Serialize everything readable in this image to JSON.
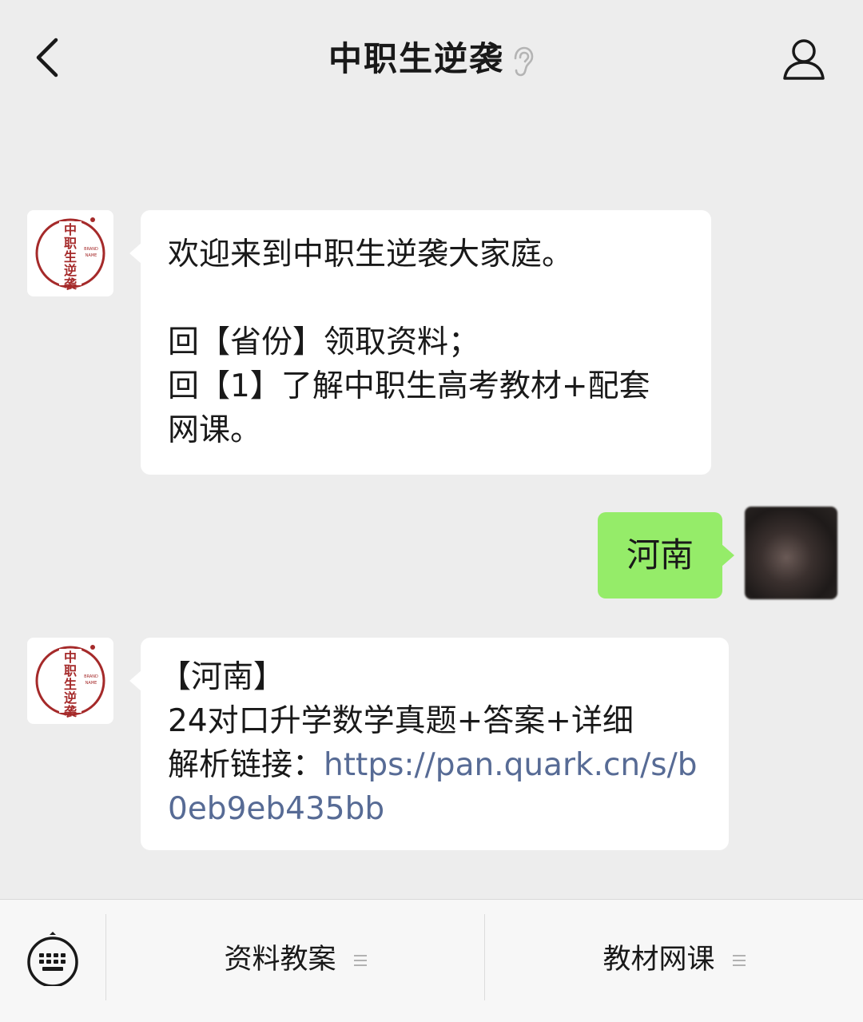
{
  "header": {
    "title": "中职生逆袭"
  },
  "messages": {
    "welcome": {
      "line1": "欢迎来到中职生逆袭大家庭。",
      "line2": "回【省份】领取资料；",
      "line3": "回【1】了解中职生高考教材+配套",
      "line4": "网课。"
    },
    "user_reply": {
      "text": "河南"
    },
    "resource": {
      "line1": "【河南】",
      "line2": "24对口升学数学真题+答案+详细",
      "line3_prefix": "解析链接：",
      "link_part1": "https://pan.quark.cn/s/b",
      "link_part2": "0eb9eb435bb"
    }
  },
  "brand_avatar": {
    "logo_text": "中职生逆袭",
    "brand_text_1": "BRAND",
    "brand_text_2": "NAME"
  },
  "bottom_menu": {
    "item1": "资料教案",
    "item2": "教材网课"
  },
  "colors": {
    "background": "#ededed",
    "bubble_green": "#95ec69",
    "link": "#576b95",
    "brand_red": "#a52a2a"
  },
  "icons": {
    "back": "chevron-left-icon",
    "ear": "ear-icon",
    "profile": "person-icon",
    "keyboard": "keyboard-icon",
    "menu": "menu-lines-icon"
  }
}
